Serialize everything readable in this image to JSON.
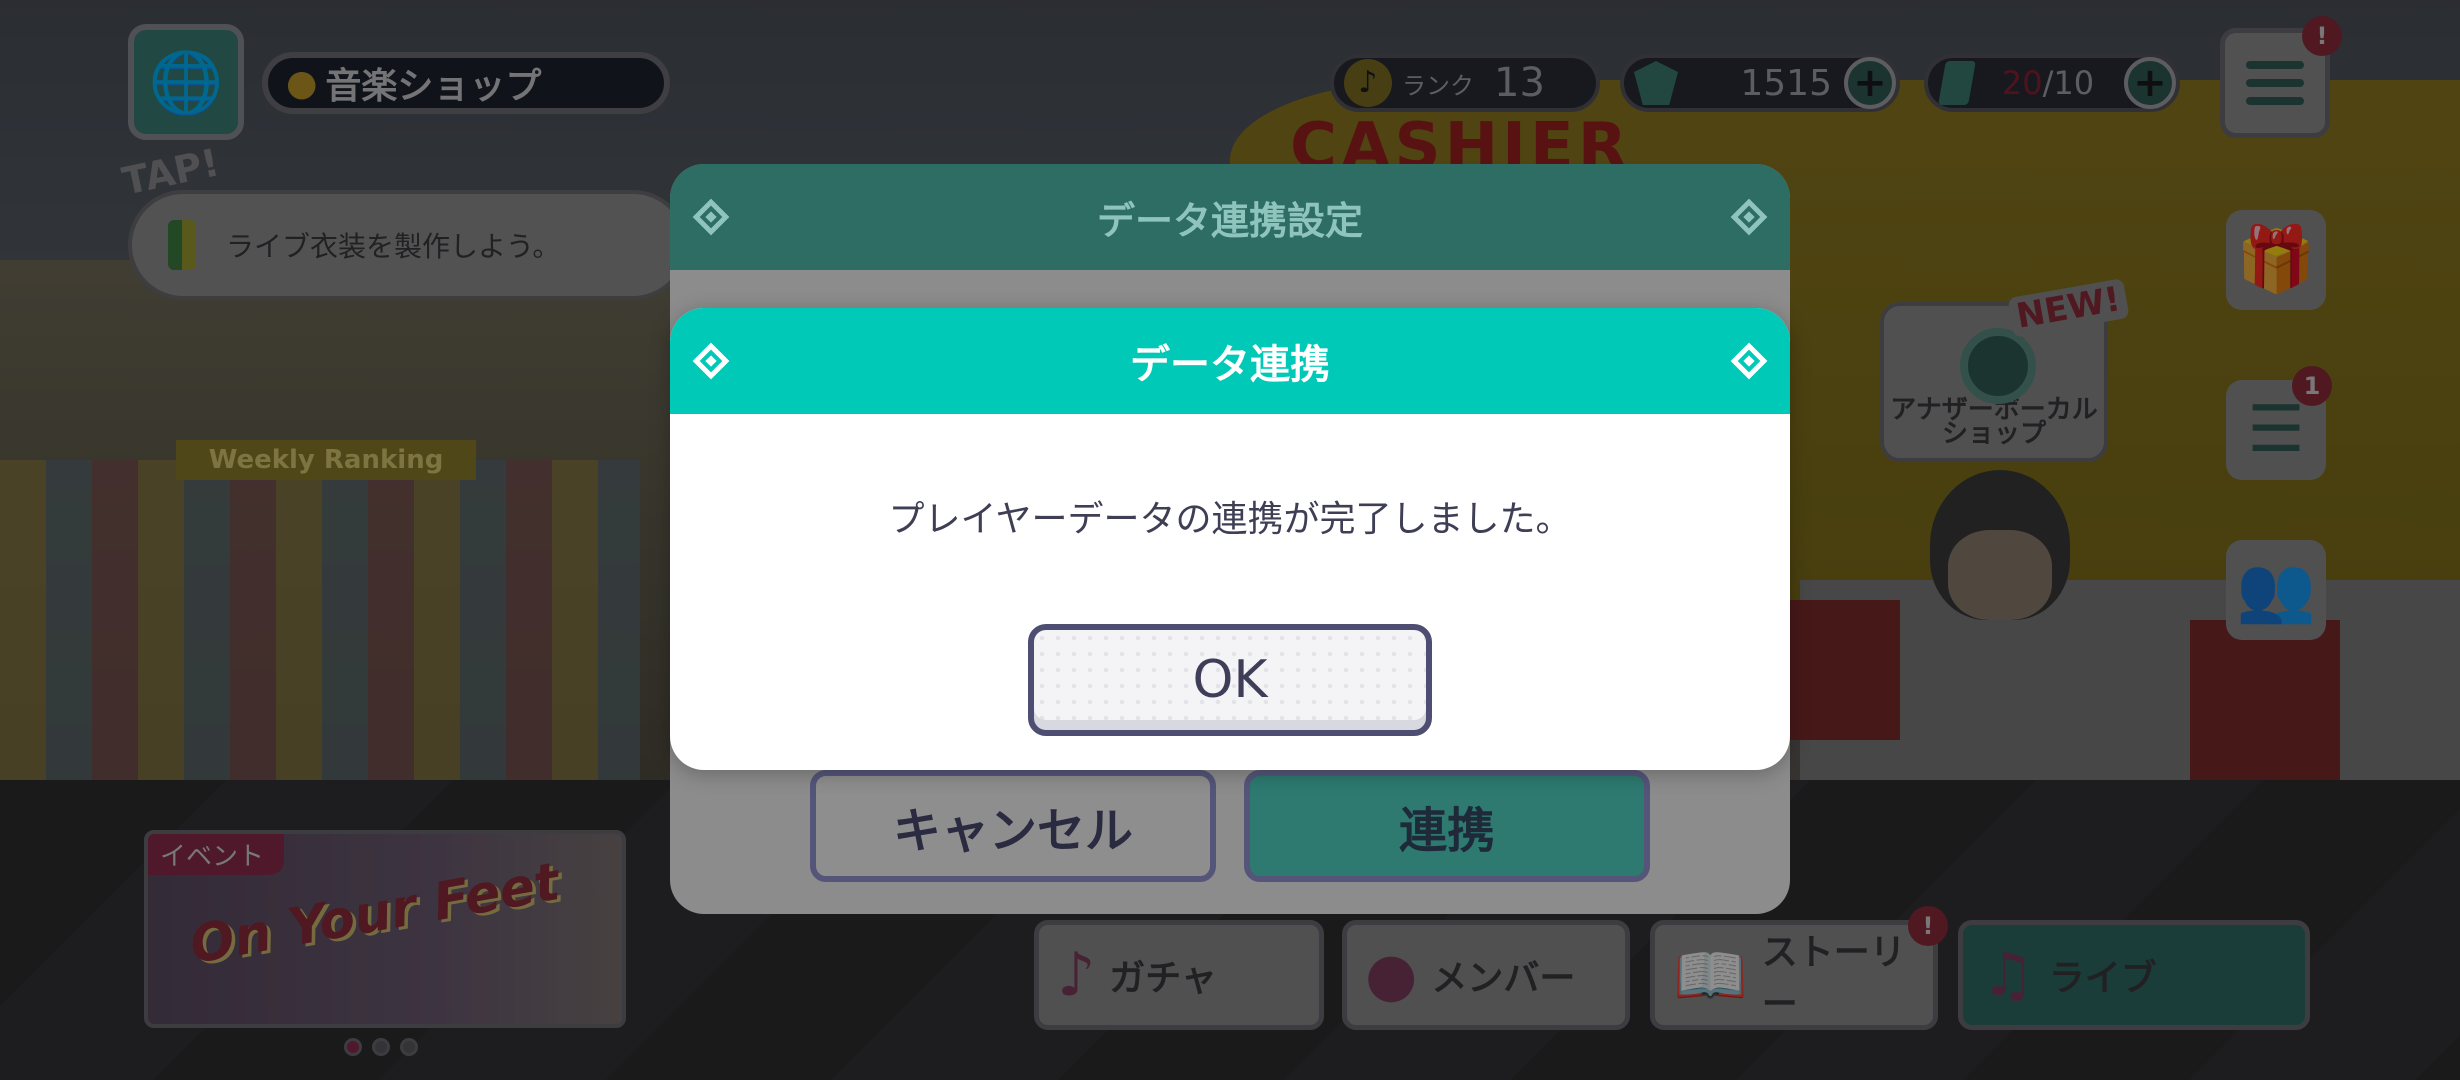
{
  "hud": {
    "location": "音楽ショップ",
    "tap_label": "TAP!",
    "mission_text": "ライブ衣装を製作しよう。",
    "rank_label": "ランク",
    "rank_value": "13",
    "gems": "1515",
    "stamina_current": "20",
    "stamina_max": "/10",
    "menu_alert": "!",
    "side_badge": "1"
  },
  "scene": {
    "weekly_sign": "Weekly Ranking",
    "cashier_sign": "CASHIER",
    "another_shop": "アナザーボーカル\nショップ",
    "new_badge": "NEW!"
  },
  "event": {
    "tag": "イベント",
    "title": "On Your Feet"
  },
  "nav": {
    "gacha": "ガチャ",
    "member": "メンバー",
    "story": "ストーリー",
    "story_alert": "!",
    "live": "ライブ"
  },
  "dialog_back": {
    "title": "データ連携設定",
    "cancel": "キャンセル",
    "confirm": "連携"
  },
  "dialog_front": {
    "title": "データ連携",
    "message": "プレイヤーデータの連携が完了しました。",
    "ok": "OK"
  },
  "colors": {
    "accent": "#00c9b8",
    "button_border": "#4e4d72"
  }
}
